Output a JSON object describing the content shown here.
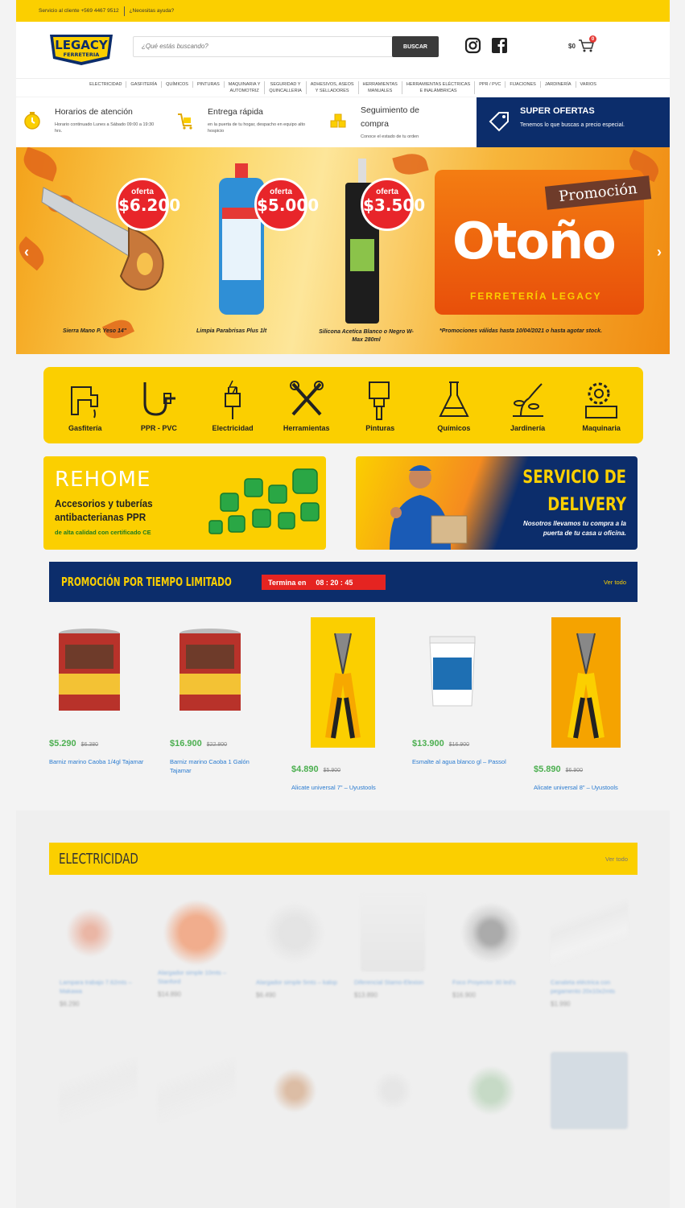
{
  "topbar": {
    "phone": "Servicio al cliente +569 4467 9512",
    "help": "¿Necesitas ayuda?"
  },
  "header": {
    "logo_line1": "LEGACY",
    "logo_line2": "FERRETERIA",
    "search_placeholder": "¿Qué estás buscando?",
    "search_button": "BUSCAR",
    "cart_total": "$0",
    "cart_count": "0"
  },
  "nav": {
    "items": [
      [
        "ELECTRICIDAD"
      ],
      [
        "GASFITERÍA"
      ],
      [
        "QUÍMICOS"
      ],
      [
        "PINTURAS"
      ],
      [
        "MAQUINARIA Y",
        "AUTOMOTRIZ"
      ],
      [
        "SEGURIDAD Y",
        "QUINCALLERIA"
      ],
      [
        "ADHESIVOS, ASEOS",
        "Y SELLADORES"
      ],
      [
        "HERRAMIENTAS",
        "MANUALES"
      ],
      [
        "HERRAMIENTAS ELÉCTRICAS",
        "E INALÁMBRICAS"
      ],
      [
        "PPR / PVC"
      ],
      [
        "FIJACIONES"
      ],
      [
        "JARDINERÍA"
      ],
      [
        "VARIOS"
      ]
    ]
  },
  "features": [
    {
      "title": "Horarios de atención",
      "desc": "Horario continuado Lunes a Sábado 09:00 a 19:30 hrs.",
      "icon": "clock-icon"
    },
    {
      "title": "Entrega rápida",
      "desc": "en la puerta de tu hogar, despacho en equipo alto hospicio",
      "icon": "delivery-cart-icon"
    },
    {
      "title": "Seguimiento de compra",
      "desc": "Conoce el estado de tu orden",
      "icon": "boxes-icon"
    }
  ],
  "super_ofertas": {
    "title": "SUPER OFERTAS",
    "desc": "Tenemos lo que buscas a precio especial."
  },
  "hero": {
    "offers": [
      {
        "label": "oferta",
        "price": "$6.200",
        "product": "Sierra Mano P. Yeso 14\""
      },
      {
        "label": "oferta",
        "price": "$5.000",
        "product": "Limpia Parabrisas Plus 1lt"
      },
      {
        "label": "oferta",
        "price": "$3.500",
        "product": "Silicona Acetica Blanco o Negro W-Max 280ml"
      }
    ],
    "promo_title": "Promoción",
    "promo_big": "Otoño",
    "promo_sub": "FERRETERÍA LEGACY",
    "disclaimer": "*Promociones válidas hasta 10/04/2021 o hasta agotar stock."
  },
  "categories": [
    "Gasfitería",
    "PPR - PVC",
    "Electricidad",
    "Herramientas",
    "Pinturas",
    "Químicos",
    "Jardinería",
    "Maquinaria"
  ],
  "banners": {
    "rehome": {
      "title": "REHOME",
      "line1": "Accesorios y tuberías",
      "line2": "antibacterianas PPR",
      "line3": "de alta calidad con certificado CE"
    },
    "delivery": {
      "title1": "SERVICIO DE",
      "title2": "DELIVERY",
      "desc1": "Nosotros llevamos tu compra a la",
      "desc2": "puerta de tu casa u oficina."
    }
  },
  "limited": {
    "title": "PROMOCIÓN POR TIEMPO LIMITADO",
    "ends_label": "Termina en",
    "countdown": "08 : 20 : 45",
    "view_all": "Ver todo"
  },
  "limited_products": [
    {
      "price": "$5.290",
      "old": "$6.380",
      "name": "Barniz marino Caoba 1/4gl Tajamar"
    },
    {
      "price": "$16.900",
      "old": "$22.800",
      "name": "Barniz marino Caoba 1 Galón Tajamar"
    },
    {
      "price": "$4.890",
      "old": "$5.900",
      "name": "Alicate universal 7\" – Uyustools"
    },
    {
      "price": "$13.900",
      "old": "$16.900",
      "name": "Esmalte al agua blanco gl – Passol"
    },
    {
      "price": "$5.890",
      "old": "$6.900",
      "name": "Alicate universal 8\" – Uyustools"
    }
  ],
  "electricidad": {
    "title": "ELECTRICIDAD",
    "view_all": "Ver todo",
    "row1": [
      {
        "name": "Lampara trabajo 7.62mts – Makawa",
        "price": "$6.290"
      },
      {
        "name": "Alargador simple 10mts – Stanford",
        "price": "$14.890"
      },
      {
        "name": "Alargador simple 5mts – kalop",
        "price": "$6.490"
      },
      {
        "name": "Diferencial Stamo-Elexion",
        "price": "$13.890"
      },
      {
        "name": "Foco Proyector 30 led's",
        "price": "$16.900"
      },
      {
        "name": "Canaleta eléctrica con pegamento 20x10x2mts",
        "price": "$1.990"
      }
    ]
  },
  "colors": {
    "yellow": "#fbcf00",
    "navy": "#0c2d6b",
    "red": "#e52421",
    "green": "#4caf50",
    "link": "#2a7bd0"
  }
}
